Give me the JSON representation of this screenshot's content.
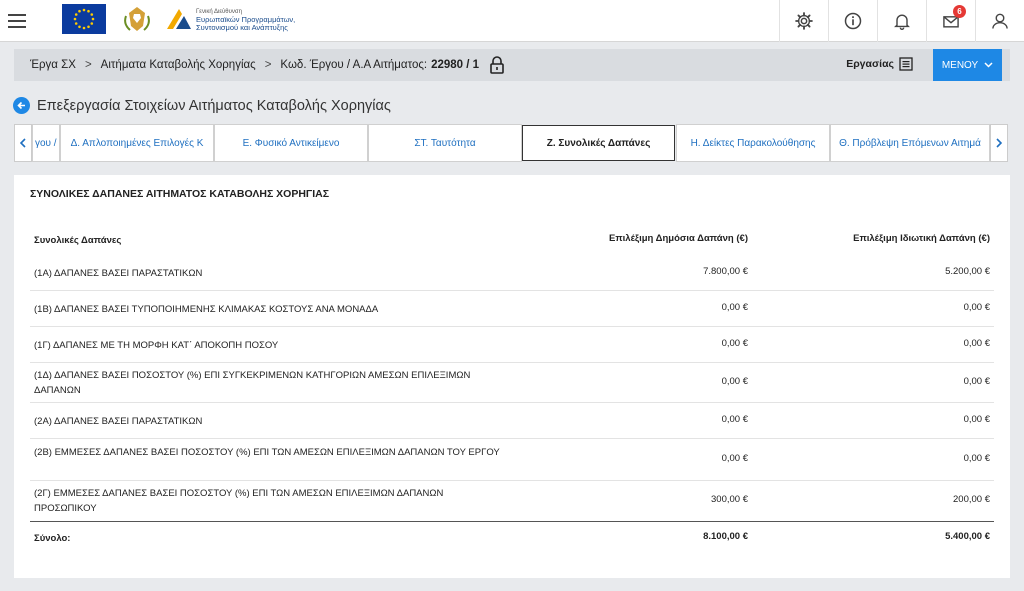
{
  "header": {
    "logo_text_lines": [
      "Γενική Διεύθυνση",
      "Ευρωπαϊκών Προγραμμάτων,",
      "Συντονισμού και Ανάπτυξης"
    ],
    "notification_count": "6",
    "icons": [
      "menu-icon",
      "gear-icon",
      "info-icon",
      "bell-icon",
      "mail-icon",
      "user-icon"
    ]
  },
  "breadcrumb": {
    "items": [
      "Έργα ΣΧ",
      "Αιτήματα Καταβολής Χορηγίας"
    ],
    "code_label": "Κωδ. Έργου / Α.Α Αιτήματος:",
    "code_value": "22980 / 1",
    "tasks_label": "Εργασίας",
    "menu_label": "ΜΕΝΟΥ"
  },
  "page": {
    "title": "Επεξεργασία Στοιχείων Αιτήματος Καταβολής Χορηγίας"
  },
  "tabs": [
    {
      "label": "γου / ",
      "active": false
    },
    {
      "label": "Δ. Απλοποιημένες Επιλογές Κ",
      "active": false
    },
    {
      "label": "Ε. Φυσικό Αντικείμενο",
      "active": false
    },
    {
      "label": "ΣΤ. Ταυτότητα",
      "active": false
    },
    {
      "label": "Ζ. Συνολικές Δαπάνες",
      "active": true
    },
    {
      "label": "Η. Δείκτες Παρακολούθησης",
      "active": false
    },
    {
      "label": "Θ. Πρόβλεψη Επόμενων Αιτημά",
      "active": false
    }
  ],
  "section": {
    "title": "ΣΥΝΟΛΙΚΕΣ ΔΑΠΑΝΕΣ ΑΙΤΗΜΑΤΟΣ ΚΑΤΑΒΟΛΗΣ ΧΟΡΗΓΙΑΣ",
    "columns": [
      "Συνολικές Δαπάνες",
      "Επιλέξιμη Δημόσια Δαπάνη (€)",
      "Επιλέξιμη Ιδιωτική Δαπάνη (€)"
    ],
    "rows": [
      {
        "label": "(1Α) ΔΑΠΑΝΕΣ ΒΑΣΕΙ ΠΑΡΑΣΤΑΤΙΚΩΝ",
        "public": "7.800,00 €",
        "private": "5.200,00 €"
      },
      {
        "label": "(1Β) ΔΑΠΑΝΕΣ ΒΑΣΕΙ ΤΥΠΟΠΟΙΗΜΕΝΗΣ ΚΛΙΜΑΚΑΣ ΚΟΣΤΟΥΣ ΑΝΑ ΜΟΝΑΔΑ",
        "public": "0,00 €",
        "private": "0,00 €"
      },
      {
        "label": "(1Γ) ΔΑΠΑΝΕΣ ΜΕ ΤΗ ΜΟΡΦΗ ΚΑΤ΄ ΑΠΟΚΟΠΗ ΠΟΣΟΥ",
        "public": "0,00 €",
        "private": "0,00 €"
      },
      {
        "label": "(1Δ) ΔΑΠΑΝΕΣ ΒΑΣΕΙ ΠΟΣΟΣΤΟΥ (%) ΕΠΙ ΣΥΓΚΕΚΡΙΜΕΝΩΝ ΚΑΤΗΓΟΡΙΩΝ ΑΜΕΣΩΝ ΕΠΙΛΕΞΙΜΩΝ ΔΑΠΑΝΩΝ",
        "public": "0,00 €",
        "private": "0,00 €"
      },
      {
        "label": "(2Α) ΔΑΠΑΝΕΣ ΒΑΣΕΙ ΠΑΡΑΣΤΑΤΙΚΩΝ",
        "public": "0,00 €",
        "private": "0,00 €"
      },
      {
        "label": "(2Β) ΕΜΜΕΣΕΣ ΔΑΠΑΝΕΣ ΒΑΣΕΙ ΠΟΣΟΣΤΟΥ (%) ΕΠΙ ΤΩΝ ΑΜΕΣΩΝ ΕΠΙΛΕΞΙΜΩΝ ΔΑΠΑΝΩΝ ΤΟΥ ΕΡΓΟΥ",
        "public": "0,00 €",
        "private": "0,00 €"
      },
      {
        "label": "(2Γ) ΕΜΜΕΣΕΣ ΔΑΠΑΝΕΣ ΒΑΣΕΙ ΠΟΣΟΣΤΟΥ (%) ΕΠΙ ΤΩΝ ΑΜΕΣΩΝ ΕΠΙΛΕΞΙΜΩΝ ΔΑΠΑΝΩΝ ΠΡΟΣΩΠΙΚΟΥ",
        "public": "300,00 €",
        "private": "200,00 €"
      }
    ],
    "total": {
      "label": "Σύνολο:",
      "public": "8.100,00 €",
      "private": "5.400,00 €"
    }
  }
}
